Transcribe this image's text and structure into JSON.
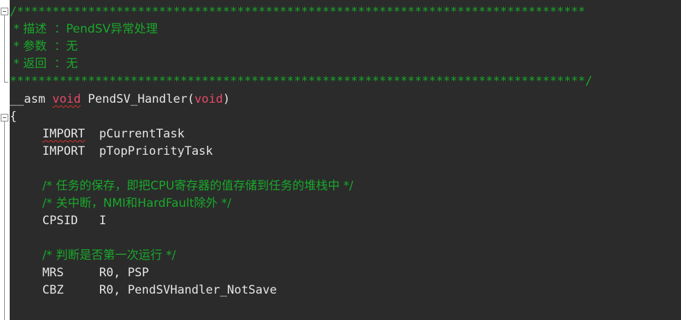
{
  "editor": {
    "header_comment": {
      "top_border": "/********************************************************************************",
      "desc_line": " * 描述  ：PendSV异常处理",
      "param_line": " * 参数  ：无",
      "return_line": " * 返回  ：无",
      "bottom_border": "*********************************************************************************/"
    },
    "func_prefix": "__asm ",
    "func_void_kw": "void",
    "func_name": " PendSV_Handler(",
    "func_param_kw": "void",
    "func_close": ")",
    "open_brace": "{",
    "import1_kw": "IMPORT",
    "import1_sym": "  pCurrentTask",
    "import2_kw": "IMPORT",
    "import2_sym": "  pTopPriorityTask",
    "comment_save": "/* 任务的保存，即把CPU寄存器的值存储到任务的堆栈中 */",
    "comment_disable_irq": "/* 关中断，NMI和HardFault除外 */",
    "cpsid_line": "CPSID   I",
    "comment_first_run": "/* 判断是否第一次运行 */",
    "mrs_line": "MRS     R0, PSP",
    "cbz_line": "CBZ     R0, PendSVHandler_NotSave"
  },
  "colors": {
    "background": "#2b2b2b",
    "comment": "#19a82b",
    "keyword": "#e84a6a",
    "text": "#e6e6e6"
  }
}
